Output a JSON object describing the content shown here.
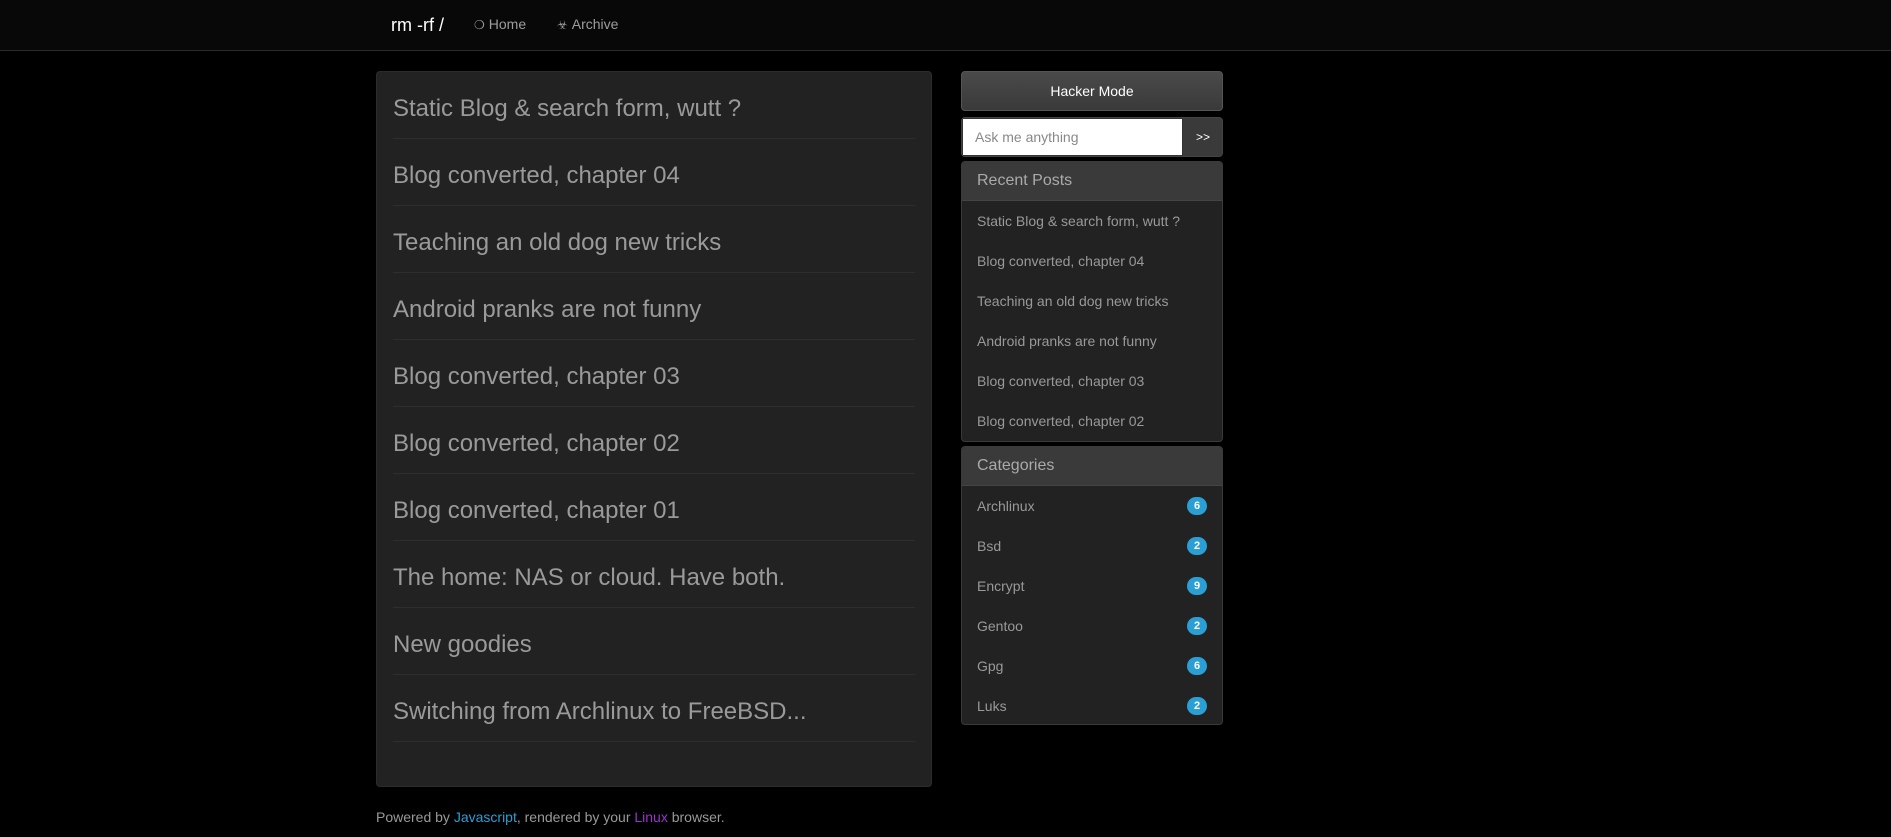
{
  "nav": {
    "brand": "rm -rf /",
    "home_icon": "❍",
    "home_label": "Home",
    "archive_icon": "☣",
    "archive_label": "Archive"
  },
  "posts": [
    {
      "title": "Static Blog & search form, wutt ?"
    },
    {
      "title": "Blog converted, chapter 04"
    },
    {
      "title": "Teaching an old dog new tricks"
    },
    {
      "title": "Android pranks are not funny"
    },
    {
      "title": "Blog converted, chapter 03"
    },
    {
      "title": "Blog converted, chapter 02"
    },
    {
      "title": "Blog converted, chapter 01"
    },
    {
      "title": "The home: NAS or cloud. Have both."
    },
    {
      "title": "New goodies"
    },
    {
      "title": "Switching from Archlinux to FreeBSD..."
    }
  ],
  "sidebar": {
    "hacker_button": "Hacker Mode",
    "search": {
      "placeholder": "Ask me anything",
      "button": ">>"
    },
    "recent": {
      "heading": "Recent Posts",
      "items": [
        "Static Blog & search form, wutt ?",
        "Blog converted, chapter 04",
        "Teaching an old dog new tricks",
        "Android pranks are not funny",
        "Blog converted, chapter 03",
        "Blog converted, chapter 02"
      ]
    },
    "categories": {
      "heading": "Categories",
      "items": [
        {
          "name": "Archlinux",
          "count": "6"
        },
        {
          "name": "Bsd",
          "count": "2"
        },
        {
          "name": "Encrypt",
          "count": "9"
        },
        {
          "name": "Gentoo",
          "count": "2"
        },
        {
          "name": "Gpg",
          "count": "6"
        },
        {
          "name": "Luks",
          "count": "2"
        }
      ]
    }
  },
  "footer": {
    "prefix": "Powered by ",
    "js_link": "Javascript",
    "middle": ", rendered by your ",
    "linux_link": "Linux",
    "suffix": " browser."
  },
  "colors": {
    "accent_blue": "#2a9fd6",
    "accent_purple": "#9933cc",
    "background": "#000000",
    "panel": "#222222"
  }
}
